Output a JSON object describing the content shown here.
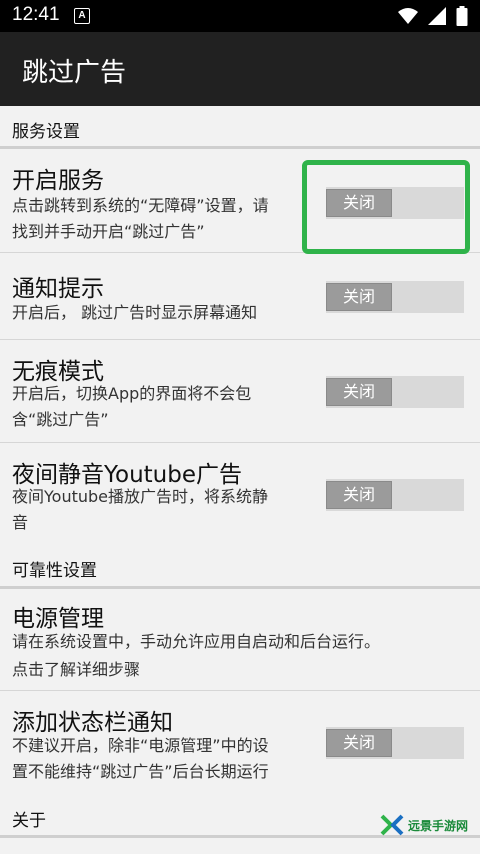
{
  "status_bar": {
    "time": "12:41",
    "notification_letter": "A",
    "icons": [
      "wifi-icon",
      "signal-icon",
      "battery-icon"
    ]
  },
  "app_bar": {
    "title": "跳过广告"
  },
  "sections": {
    "service": "服务设置",
    "reliability": "可靠性设置",
    "about": "关于"
  },
  "items": {
    "enable_service": {
      "title": "开启服务",
      "summary_line1": "点击跳转到系统的“无障碍”设置，请",
      "summary_line2": "找到并手动开启“跳过广告”",
      "toggle": "关闭"
    },
    "notification_hint": {
      "title": "通知提示",
      "summary_line1": "开启后， 跳过广告时显示屏幕通知",
      "toggle": "关闭"
    },
    "incognito": {
      "title": "无痕模式",
      "summary_line1": "开启后，切换App的界面将不会包",
      "summary_line2": "含“跳过广告”",
      "toggle": "关闭"
    },
    "night_mute": {
      "title": "夜间静音Youtube广告",
      "summary_line1": "夜间Youtube播放广告时，将系统静",
      "summary_line2": "音",
      "toggle": "关闭"
    },
    "power_management": {
      "title": "电源管理",
      "summary_line1": "请在系统设置中，手动允许应用自启动和后台运行。",
      "summary_line2": "点击了解详细步骤"
    },
    "status_bar_notification": {
      "title": "添加状态栏通知",
      "summary_line1": "不建议开启，除非“电源管理”中的设",
      "summary_line2": "置不能维持“跳过广告”后台长期运行",
      "toggle": "关闭"
    }
  },
  "watermark": {
    "text": "远景手游网"
  },
  "colors": {
    "highlight": "#2fb34a",
    "app_bar": "#212121",
    "background": "#f2f2f2"
  }
}
